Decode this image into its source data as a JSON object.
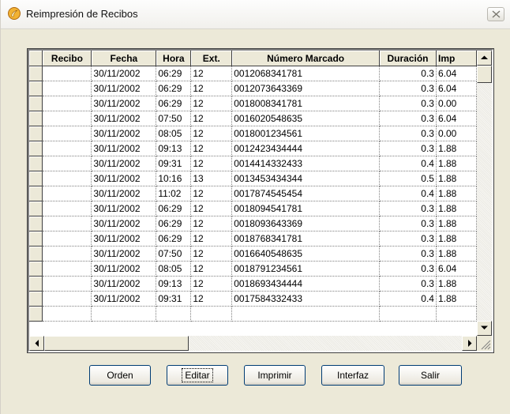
{
  "window": {
    "title": "Reimpresión de Recibos",
    "icon": "receipt-app-icon",
    "close_icon": "close-icon"
  },
  "grid": {
    "columns": [
      "Recibo",
      "Fecha",
      "Hora",
      "Ext.",
      "Número Marcado",
      "Duración",
      "Imp"
    ],
    "rows": [
      [
        "",
        "30/11/2002",
        "06:29",
        "12",
        "0012068341781",
        "0.3",
        "6.04"
      ],
      [
        "",
        "30/11/2002",
        "06:29",
        "12",
        "0012073643369",
        "0.3",
        "6.04"
      ],
      [
        "",
        "30/11/2002",
        "06:29",
        "12",
        "0018008341781",
        "0.3",
        "0.00"
      ],
      [
        "",
        "30/11/2002",
        "07:50",
        "12",
        "0016020548635",
        "0.3",
        "6.04"
      ],
      [
        "",
        "30/11/2002",
        "08:05",
        "12",
        "0018001234561",
        "0.3",
        "0.00"
      ],
      [
        "",
        "30/11/2002",
        "09:13",
        "12",
        "0012423434444",
        "0.3",
        "1.88"
      ],
      [
        "",
        "30/11/2002",
        "09:31",
        "12",
        "0014414332433",
        "0.4",
        "1.88"
      ],
      [
        "",
        "30/11/2002",
        "10:16",
        "13",
        "0013453434344",
        "0.5",
        "1.88"
      ],
      [
        "",
        "30/11/2002",
        "11:02",
        "12",
        "0017874545454",
        "0.4",
        "1.88"
      ],
      [
        "",
        "30/11/2002",
        "06:29",
        "12",
        "0018094541781",
        "0.3",
        "1.88"
      ],
      [
        "",
        "30/11/2002",
        "06:29",
        "12",
        "0018093643369",
        "0.3",
        "1.88"
      ],
      [
        "",
        "30/11/2002",
        "06:29",
        "12",
        "0018768341781",
        "0.3",
        "1.88"
      ],
      [
        "",
        "30/11/2002",
        "07:50",
        "12",
        "0016640548635",
        "0.3",
        "1.88"
      ],
      [
        "",
        "30/11/2002",
        "08:05",
        "12",
        "0018791234561",
        "0.3",
        "6.04"
      ],
      [
        "",
        "30/11/2002",
        "09:13",
        "12",
        "0018693434444",
        "0.3",
        "1.88"
      ],
      [
        "",
        "30/11/2002",
        "09:31",
        "12",
        "0017584332433",
        "0.4",
        "1.88"
      ],
      [
        "",
        "",
        "",
        "",
        "",
        "",
        ""
      ]
    ]
  },
  "buttons": {
    "orden": "Orden",
    "editar": "Editar",
    "imprimir": "Imprimir",
    "interfaz": "Interfaz",
    "salir": "Salir"
  }
}
